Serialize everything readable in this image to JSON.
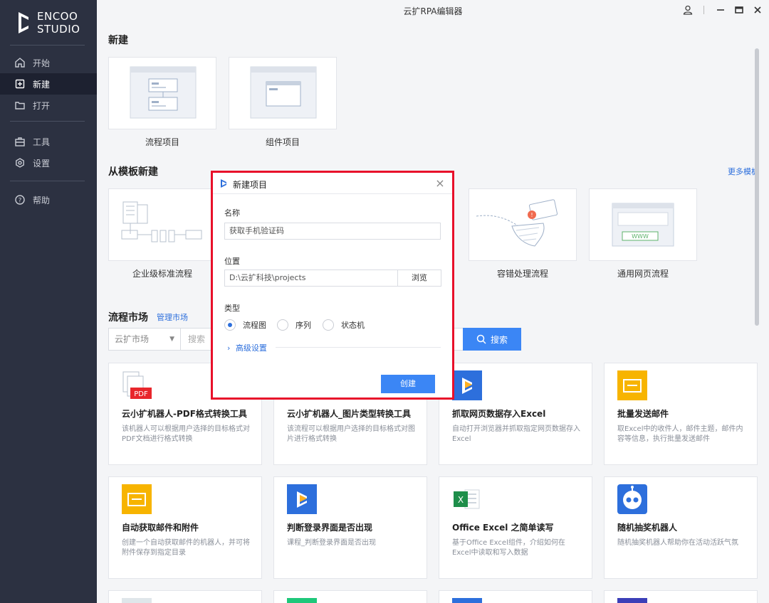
{
  "app": {
    "title": "云扩RPA编辑器"
  },
  "logo": {
    "line1": "ENCOO",
    "line2": "STUDIO"
  },
  "sidebar": {
    "items": [
      {
        "label": "开始",
        "icon": "home-icon"
      },
      {
        "label": "新建",
        "icon": "new-icon",
        "active": true
      },
      {
        "label": "打开",
        "icon": "folder-icon"
      },
      {
        "label": "工具",
        "icon": "toolbox-icon"
      },
      {
        "label": "设置",
        "icon": "gear-icon"
      },
      {
        "label": "帮助",
        "icon": "help-icon"
      }
    ]
  },
  "new_section": {
    "title": "新建",
    "tiles": [
      {
        "label": "流程项目"
      },
      {
        "label": "组件项目"
      }
    ]
  },
  "template_section": {
    "title": "从模板新建",
    "more": "更多模板",
    "tiles": [
      {
        "label": "企业级标准流程"
      },
      {
        "label": "容错处理流程"
      },
      {
        "label": "通用网页流程"
      }
    ],
    "www_text": "WWW"
  },
  "market": {
    "title": "流程市场",
    "manage": "管理市场",
    "select_value": "云扩市场",
    "search_placeholder": "搜索",
    "search_button": "搜索",
    "cards": [
      {
        "title": "云小扩机器人-PDF格式转换工具",
        "desc": "该机器人可以根据用户选择的目标格式对PDF文档进行格式转换",
        "icon": "pdf-icon",
        "badge": "PDF"
      },
      {
        "title": "云小扩机器人_图片类型转换工具",
        "desc": "该流程可以根据用户选择的目标格式对图片进行格式转换",
        "icon": "image-icon"
      },
      {
        "title": "抓取网页数据存入Excel",
        "desc": "自动打开浏览器并抓取指定网页数据存入Excel",
        "icon": "encoo-icon"
      },
      {
        "title": "批量发送邮件",
        "desc": "取Excel中的收件人，邮件主题，邮件内容等信息，执行批量发送邮件",
        "icon": "mail-icon"
      },
      {
        "title": "自动获取邮件和附件",
        "desc": "创建一个自动获取邮件的机器人，并可将附件保存到指定目录",
        "icon": "mail-icon"
      },
      {
        "title": "判断登录界面是否出现",
        "desc": "课程_判断登录界面是否出现",
        "icon": "encoo-icon"
      },
      {
        "title": "Office Excel 之简单读写",
        "desc": "基于Office Excel组件，介绍如何在Excel中读取和写入数据",
        "icon": "excel-icon",
        "badge": "X"
      },
      {
        "title": "随机抽奖机器人",
        "desc": "随机抽奖机器人帮助你在活动活跃气氛",
        "icon": "robot-icon"
      }
    ]
  },
  "dialog": {
    "title": "新建项目",
    "name_label": "名称",
    "name_value": "获取手机验证码",
    "location_label": "位置",
    "location_value": "D:\\云扩科技\\projects",
    "browse": "浏览",
    "type_label": "类型",
    "types": [
      {
        "label": "流程图",
        "checked": true
      },
      {
        "label": "序列"
      },
      {
        "label": "状态机"
      }
    ],
    "advanced": "高级设置",
    "create": "创建"
  },
  "colors": {
    "sidebar": "#2c3141",
    "accent": "#3b86f5",
    "highlight": "#e8102a",
    "mail": "#f7b400"
  }
}
